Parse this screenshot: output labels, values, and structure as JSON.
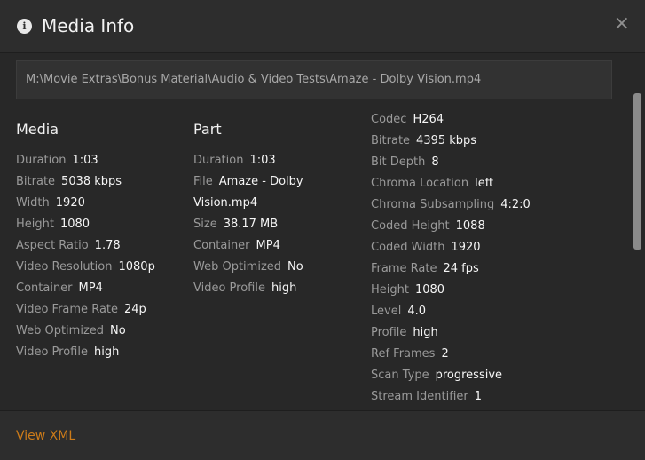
{
  "header": {
    "title": "Media Info",
    "info_icon": "info-icon",
    "close_label": "×"
  },
  "file_path": "M:\\Movie Extras\\Bonus Material\\Audio & Video Tests\\Amaze - Dolby Vision.mp4",
  "media": {
    "title": "Media",
    "rows": [
      {
        "label": "Duration",
        "value": "1:03"
      },
      {
        "label": "Bitrate",
        "value": "5038 kbps"
      },
      {
        "label": "Width",
        "value": "1920"
      },
      {
        "label": "Height",
        "value": "1080"
      },
      {
        "label": "Aspect Ratio",
        "value": "1.78"
      },
      {
        "label": "Video Resolution",
        "value": "1080p"
      },
      {
        "label": "Container",
        "value": "MP4"
      },
      {
        "label": "Video Frame Rate",
        "value": "24p"
      },
      {
        "label": "Web Optimized",
        "value": "No"
      },
      {
        "label": "Video Profile",
        "value": "high"
      }
    ]
  },
  "part": {
    "title": "Part",
    "rows": [
      {
        "label": "Duration",
        "value": "1:03"
      },
      {
        "label": "File",
        "value": "Amaze - Dolby Vision.mp4"
      },
      {
        "label": "Size",
        "value": "38.17 MB"
      },
      {
        "label": "Container",
        "value": "MP4"
      },
      {
        "label": "Web Optimized",
        "value": "No"
      },
      {
        "label": "Video Profile",
        "value": "high"
      }
    ]
  },
  "stream": {
    "rows": [
      {
        "label": "Codec",
        "value": "H264"
      },
      {
        "label": "Bitrate",
        "value": "4395 kbps"
      },
      {
        "label": "Bit Depth",
        "value": "8"
      },
      {
        "label": "Chroma Location",
        "value": "left"
      },
      {
        "label": "Chroma Subsampling",
        "value": "4:2:0"
      },
      {
        "label": "Coded Height",
        "value": "1088"
      },
      {
        "label": "Coded Width",
        "value": "1920"
      },
      {
        "label": "Frame Rate",
        "value": "24 fps"
      },
      {
        "label": "Height",
        "value": "1080"
      },
      {
        "label": "Level",
        "value": "4.0"
      },
      {
        "label": "Profile",
        "value": "high"
      },
      {
        "label": "Ref Frames",
        "value": "2"
      },
      {
        "label": "Scan Type",
        "value": "progressive"
      },
      {
        "label": "Stream Identifier",
        "value": "1"
      }
    ]
  },
  "footer": {
    "view_xml_label": "View XML"
  },
  "colors": {
    "background": "#282828",
    "header_footer": "#2d2d2d",
    "label": "#9a9a9a",
    "value": "#f5f5f5",
    "accent": "#cc7b19"
  }
}
